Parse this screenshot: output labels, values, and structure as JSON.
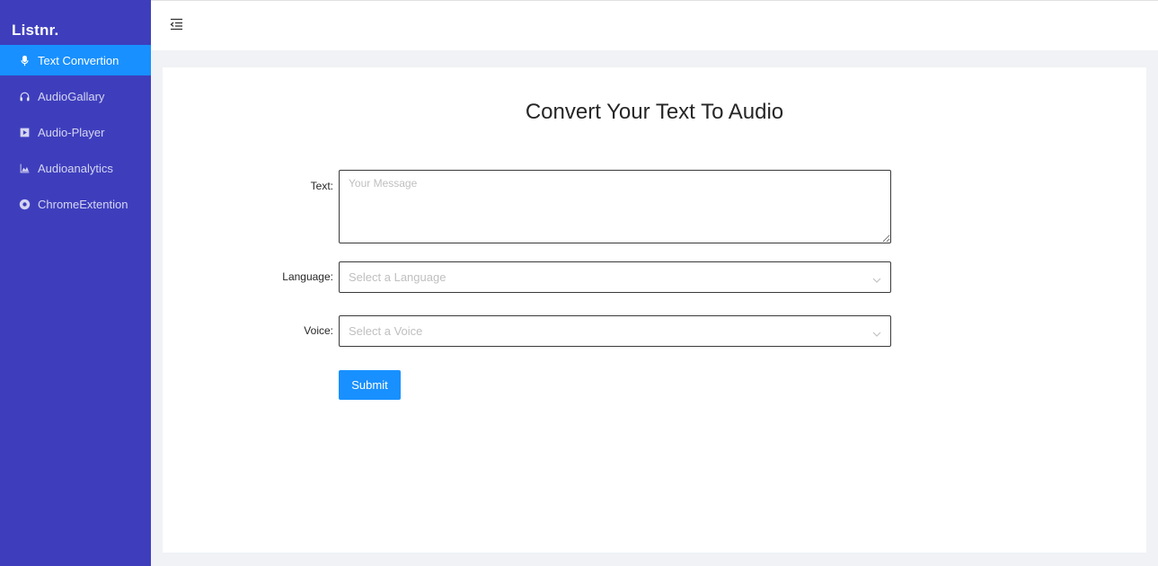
{
  "app": {
    "logo": "Listnr."
  },
  "sidebar": {
    "items": [
      {
        "label": "Text Convertion",
        "icon": "microphone-icon",
        "active": true
      },
      {
        "label": "AudioGallary",
        "icon": "headphones-icon",
        "active": false
      },
      {
        "label": "Audio-Player",
        "icon": "play-square-icon",
        "active": false
      },
      {
        "label": "Audioanalytics",
        "icon": "area-chart-icon",
        "active": false
      },
      {
        "label": "ChromeExtention",
        "icon": "chrome-icon",
        "active": false
      }
    ]
  },
  "header": {
    "fold_icon": "menu-fold-icon"
  },
  "main": {
    "title": "Convert Your Text To Audio",
    "form": {
      "text_label": "Text",
      "text_placeholder": "Your Message",
      "text_value": "",
      "language_label": "Language",
      "language_placeholder": "Select a Language",
      "voice_label": "Voice",
      "voice_placeholder": "Select a Voice",
      "submit_label": "Submit"
    }
  },
  "colors": {
    "sidebar_bg": "#3e3ebd",
    "active_item_bg": "#1890ff",
    "primary_button": "#1890ff",
    "page_bg": "#f0f2f5"
  }
}
